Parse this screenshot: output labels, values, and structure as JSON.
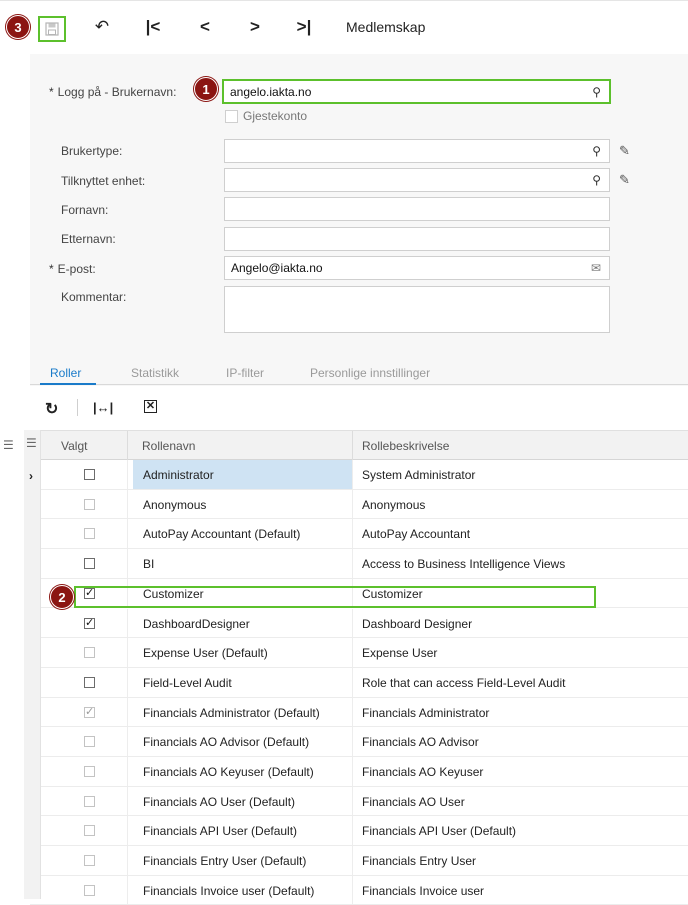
{
  "toolbar": {
    "title": "Medlemskap",
    "icons": [
      "save-icon",
      "undo-icon",
      "first-icon",
      "prev-icon",
      "next-icon",
      "last-icon"
    ]
  },
  "markers": {
    "m1": "1",
    "m2": "2",
    "m3": "3"
  },
  "form": {
    "login_label": "Logg på - Brukernavn:",
    "login_value": "angelo.iakta.no",
    "guest_label": "Gjestekonto",
    "usertype_label": "Brukertype:",
    "usertype_value": "",
    "unit_label": "Tilknyttet enhet:",
    "unit_value": "",
    "firstname_label": "Fornavn:",
    "firstname_value": "",
    "lastname_label": "Etternavn:",
    "lastname_value": "",
    "email_label": "E-post:",
    "email_value": "Angelo@iakta.no",
    "comment_label": "Kommentar:",
    "comment_value": "",
    "required_mark": "*"
  },
  "tabs": [
    "Roller",
    "Statistikk",
    "IP-filter",
    "Personlige innstillinger"
  ],
  "grid": {
    "columns": {
      "selected": "Valgt",
      "name": "Rollenavn",
      "desc": "Rollebeskrivelse"
    },
    "rows": [
      {
        "name": "Administrator",
        "desc": "System Administrator",
        "checked": false
      },
      {
        "name": "Anonymous",
        "desc": "Anonymous",
        "checked": false
      },
      {
        "name": "AutoPay Accountant (Default)",
        "desc": "AutoPay Accountant",
        "checked": false
      },
      {
        "name": "BI",
        "desc": "Access to Business Intelligence Views",
        "checked": false
      },
      {
        "name": "Customizer",
        "desc": "Customizer",
        "checked": true
      },
      {
        "name": "DashboardDesigner",
        "desc": "Dashboard Designer",
        "checked": true
      },
      {
        "name": "Expense User (Default)",
        "desc": "Expense User",
        "checked": false
      },
      {
        "name": "Field-Level Audit",
        "desc": "Role that can access Field-Level Audit",
        "checked": false
      },
      {
        "name": "Financials Administrator (Default)",
        "desc": "Financials Administrator",
        "checked": true
      },
      {
        "name": "Financials AO Advisor (Default)",
        "desc": "Financials AO Advisor",
        "checked": false
      },
      {
        "name": "Financials AO Keyuser (Default)",
        "desc": "Financials AO Keyuser",
        "checked": false
      },
      {
        "name": "Financials AO User (Default)",
        "desc": "Financials AO User",
        "checked": false
      },
      {
        "name": "Financials API User (Default)",
        "desc": "Financials API User (Default)",
        "checked": false
      },
      {
        "name": "Financials Entry User (Default)",
        "desc": "Financials Entry User",
        "checked": false
      },
      {
        "name": "Financials Invoice user (Default)",
        "desc": "Financials Invoice user",
        "checked": false
      }
    ]
  },
  "colors": {
    "highlight": "#5cc02c",
    "marker": "#8b1512",
    "tab_active": "#1a7bc9",
    "row_selected": "#cfe3f3"
  }
}
